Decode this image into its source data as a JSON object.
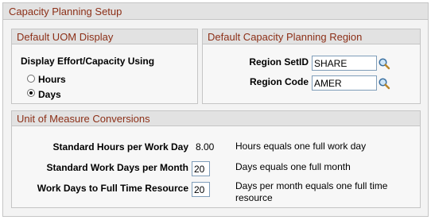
{
  "page": {
    "title": "Capacity Planning Setup"
  },
  "uom_display": {
    "title": "Default UOM Display",
    "label": "Display Effort/Capacity Using",
    "options": [
      {
        "label": "Hours",
        "selected": false
      },
      {
        "label": "Days",
        "selected": true
      }
    ]
  },
  "region": {
    "title": "Default Capacity Planning Region",
    "setid_label": "Region SetID",
    "setid_value": "SHARE",
    "code_label": "Region Code",
    "code_value": "AMER"
  },
  "conversions": {
    "title": "Unit of Measure Conversions",
    "rows": [
      {
        "label": "Standard Hours per Work Day",
        "value": "8.00",
        "description": "Hours equals one full work day"
      },
      {
        "label": "Standard Work Days per Month",
        "value": "20",
        "description": "Days equals one full month"
      },
      {
        "label": "Work Days to Full Time Resource",
        "value": "20",
        "description_line1": "Days per month equals one full time",
        "description_line2": "resource"
      }
    ]
  },
  "icons": {
    "lookup": "search-icon"
  },
  "colors": {
    "title_text": "#8c2f17",
    "header_bg": "#e2e2e2",
    "panel_bg": "#f3f3f3",
    "border": "#c5c5c5"
  }
}
